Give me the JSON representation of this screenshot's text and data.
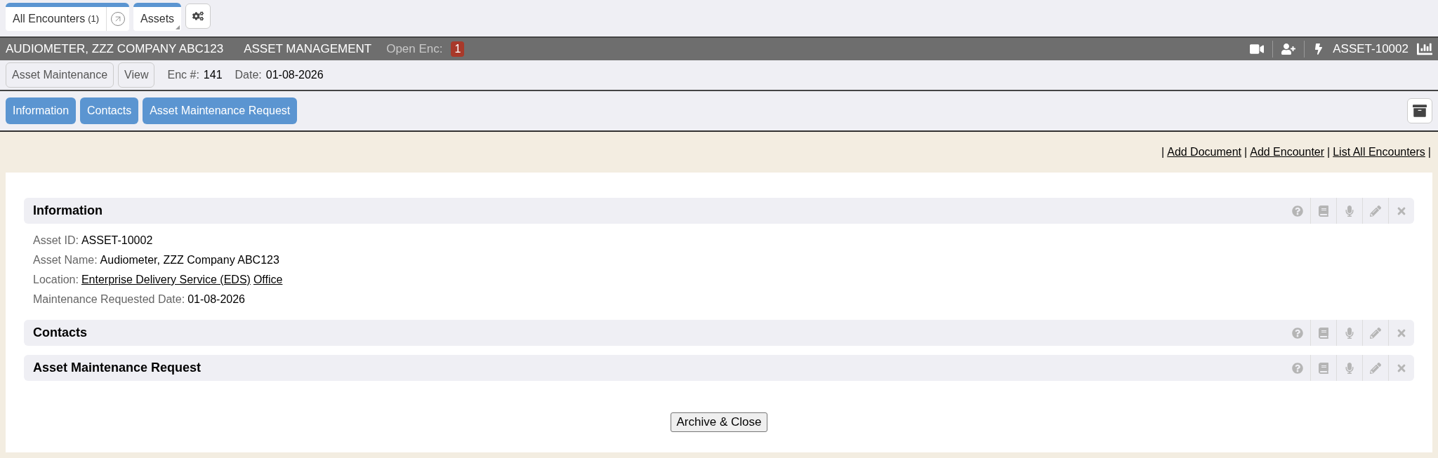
{
  "top_tabs": [
    {
      "label": "All Encounters",
      "count": "(1)",
      "kind": "popout"
    },
    {
      "label": "Assets",
      "kind": "menu"
    }
  ],
  "header": {
    "title": "AUDIOMETER, ZZZ COMPANY ABC123",
    "module": "ASSET MANAGEMENT",
    "open_enc_label": "Open Enc:",
    "open_enc_count": "1",
    "asset_id": "ASSET-10002"
  },
  "encounter_bar": {
    "buttons": [
      "Asset Maintenance",
      "View"
    ],
    "enc_label": "Enc #:",
    "enc_value": "141",
    "date_label": "Date:",
    "date_value": "01-08-2026"
  },
  "section_nav": [
    "Information",
    "Contacts",
    "Asset Maintenance Request"
  ],
  "action_link_separator": "|",
  "action_links": [
    "Add Document",
    "Add Encounter",
    "List All Encounters"
  ],
  "sections": [
    {
      "title": "Information",
      "fields": [
        {
          "label": "Asset ID:",
          "kind": "text",
          "value": "ASSET-10002"
        },
        {
          "label": "Asset Name:",
          "kind": "text",
          "value": "Audiometer, ZZZ Company ABC123"
        },
        {
          "label": "Location:",
          "kind": "links",
          "links": [
            "Enterprise Delivery Service (EDS)",
            "Office"
          ]
        },
        {
          "label": "Maintenance Requested Date:",
          "kind": "text",
          "value": "01-08-2026"
        }
      ]
    },
    {
      "title": "Contacts"
    },
    {
      "title": "Asset Maintenance Request"
    }
  ],
  "footer_button": "Archive & Close"
}
